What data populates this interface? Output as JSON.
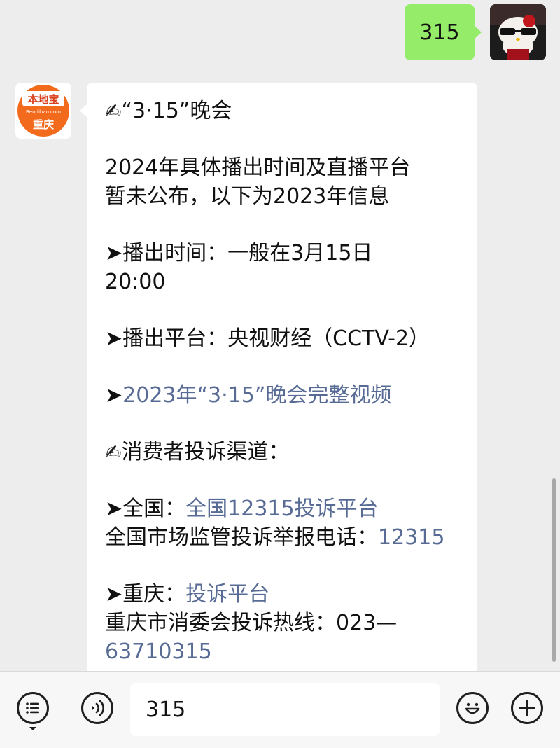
{
  "outgoing": {
    "text": "315"
  },
  "avatar_shop": {
    "logo_text": "本地宝",
    "logo_sub": "Bendibao.com",
    "city": "重庆"
  },
  "message": {
    "title_emoji": "✍",
    "title": "“3·15”晚会",
    "intro_line1": "2024年具体播出时间及直播平台",
    "intro_line2": "暂未公布，以下为2023年信息",
    "arrow": "➤",
    "time_line1": "播出时间：一般在3月15日",
    "time_line2": "20:00",
    "platform": "播出平台：央视财经（CCTV-2）",
    "video_link": "2023年“3·15”晚会完整视频",
    "complaint_emoji": "✍",
    "complaint_heading": "消费者投诉渠道：",
    "national_prefix": "全国：",
    "national_link": "全国12315投诉平台",
    "national_phone_label": "全国市场监管投诉举报电话：",
    "national_phone": "12315",
    "chongqing_prefix": "重庆：",
    "chongqing_link": "投诉平台",
    "chongqing_hotline_label": "重庆市消委会投诉热线：023—",
    "chongqing_hotline_number": "63710315"
  },
  "input": {
    "value": "315"
  },
  "icons": {
    "menu": "menu-list-icon",
    "voice": "voice-icon",
    "emoji": "emoji-icon",
    "plus": "plus-icon"
  },
  "colors": {
    "background": "#ededed",
    "outgoing_bubble": "#95ec69",
    "incoming_bubble": "#ffffff",
    "link": "#576b95",
    "logo_orange": "#f26a1b"
  }
}
